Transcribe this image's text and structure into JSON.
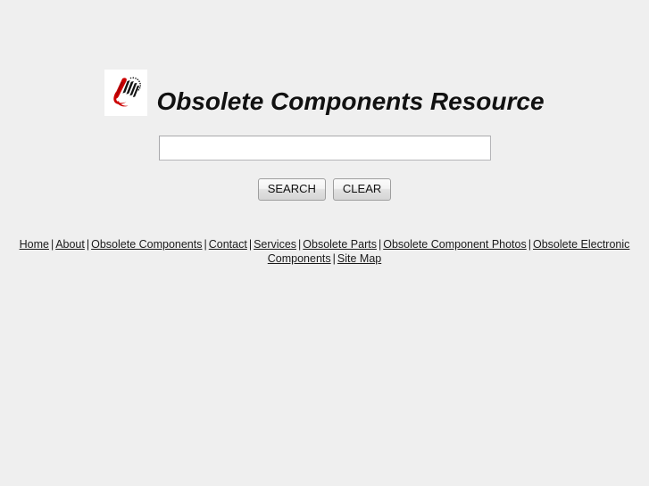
{
  "header": {
    "title": "Obsolete Components Resource",
    "logo_alt": "obsolete-components-logo",
    "logo_colors": {
      "red": "#cc0000",
      "dark_red": "#a50008",
      "black": "#111111",
      "background": "#ffffff"
    }
  },
  "search": {
    "value": "",
    "placeholder": "",
    "search_label": "SEARCH",
    "clear_label": "CLEAR"
  },
  "nav": {
    "separator": "|",
    "items": [
      {
        "label": "Home"
      },
      {
        "label": "About"
      },
      {
        "label": "Obsolete Components"
      },
      {
        "label": "Contact"
      },
      {
        "label": "Services"
      },
      {
        "label": "Obsolete Parts"
      },
      {
        "label": "Obsolete Component Photos"
      },
      {
        "label": "Obsolete Electronic Components"
      },
      {
        "label": "Site Map"
      }
    ]
  },
  "colors": {
    "page_background": "#efefef",
    "text": "#111111",
    "link": "#1a1a1a",
    "input_border": "#b5b5b8"
  }
}
